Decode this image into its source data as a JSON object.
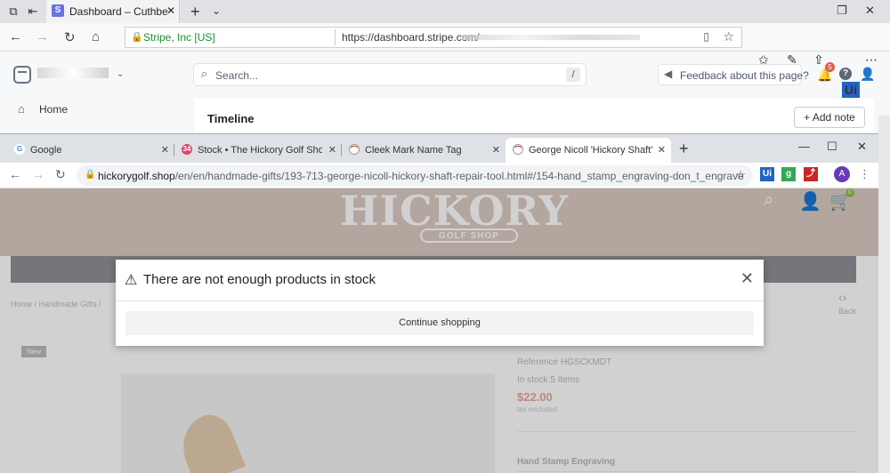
{
  "edge": {
    "tab_title": "Dashboard – Cuthbert &",
    "addr_org": "Stripe, Inc [US]",
    "addr_url": "https://dashboard.stripe.com/",
    "ext_badge": "Ui"
  },
  "stripe": {
    "search_placeholder": "Search...",
    "search_shortcut": "/",
    "feedback": "Feedback about this page?",
    "notif_count": "5",
    "nav_home": "Home",
    "timeline_title": "Timeline",
    "add_note": "Add note"
  },
  "chrome": {
    "tabs": [
      {
        "title": "Google",
        "fav": "G",
        "fav_color": "#4285f4"
      },
      {
        "title": "Stock • The Hickory Golf Shop",
        "fav": "34",
        "fav_color": "#e0426e"
      },
      {
        "title": "Cleek Mark Name Tag",
        "fav": "",
        "fav_color": "#ffffff"
      },
      {
        "title": "George Nicoll 'Hickory Shaft' Rep",
        "fav": "",
        "fav_color": "#ffffff"
      }
    ],
    "url_host": "hickorygolf.shop",
    "url_rest": "/en/en/handmade-gifts/193-713-george-nicoll-hickory-shaft-repair-tool.html#/154-hand_stamp_engraving-don_t_engrave",
    "avatar": "A",
    "ext_ui": "Ui"
  },
  "shop": {
    "logo": "HICKORY",
    "logo_sub": "GOLF SHOP",
    "cart_count": "0",
    "breadcrumb": "Home  /  Handmade Gifts  /",
    "back": "Back",
    "new_badge": "New",
    "reference": "Reference HGSCKMDT",
    "stock": "In stock 5 Items",
    "price": "$22.00",
    "tax": "tax excluded",
    "engraving_label": "Hand Stamp Engraving"
  },
  "modal": {
    "title": "There are not enough products in stock",
    "continue": "Continue shopping"
  },
  "colors": {
    "stripe_accent": "#6772e5",
    "price": "#e4a79f",
    "header_bg": "#d9cbc3"
  }
}
